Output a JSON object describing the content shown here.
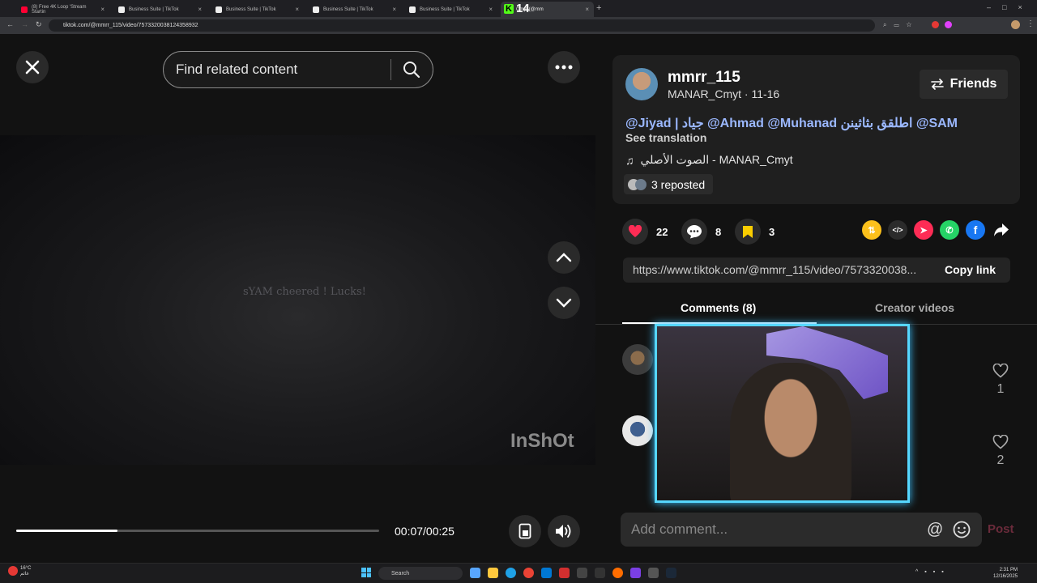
{
  "browser": {
    "tabs": [
      {
        "label": "(8) Free 4K Loop 'Stream Startin",
        "color": "#ff0033"
      },
      {
        "label": "Business Suite | TikTok",
        "color": "#ffffff"
      },
      {
        "label": "Business Suite | TikTok",
        "color": "#ffffff"
      },
      {
        "label": "Business Suite | TikTok",
        "color": "#ffffff"
      },
      {
        "label": "Business Suite | TikTok",
        "color": "#ffffff"
      },
      {
        "label": "Cmyt (@mm",
        "color": "#ffffff"
      }
    ],
    "overlay_badge": "14",
    "url": "tiktok.com/@mmrr_115/video/7573320038124358932"
  },
  "player": {
    "search_placeholder": "Find related content",
    "watermark": "InShOt",
    "video_caption_overlay": "sYAM cheered ! Lucks!",
    "time": "00:07/00:25",
    "progress": 0.28
  },
  "post": {
    "username": "mmrr_115",
    "subline": "MANAR_Cmyt · 11-16",
    "friends_label": "Friends",
    "caption": "@Jiyad | جياد @Ahmad @Muhanad اطلقق بثاثينن @SAM",
    "see_translation": "See translation",
    "music": "الصوت الأصلي - MANAR_Cmyt",
    "reposted": "3 reposted",
    "likes": "22",
    "comments": "8",
    "saves": "3",
    "link": "https://www.tiktok.com/@mmrr_115/video/7573320038...",
    "copy_link": "Copy link"
  },
  "tabs": {
    "comments": "Comments (8)",
    "creator": "Creator videos"
  },
  "comments_list": [
    {
      "likes": "1"
    },
    {
      "likes": "2"
    }
  ],
  "comment_input": {
    "placeholder": "Add comment...",
    "post": "Post"
  },
  "taskbar": {
    "weather": "16°C",
    "weather_sub": "غائم",
    "search": "Search",
    "time": "2:31 PM",
    "date": "12/16/2025"
  }
}
